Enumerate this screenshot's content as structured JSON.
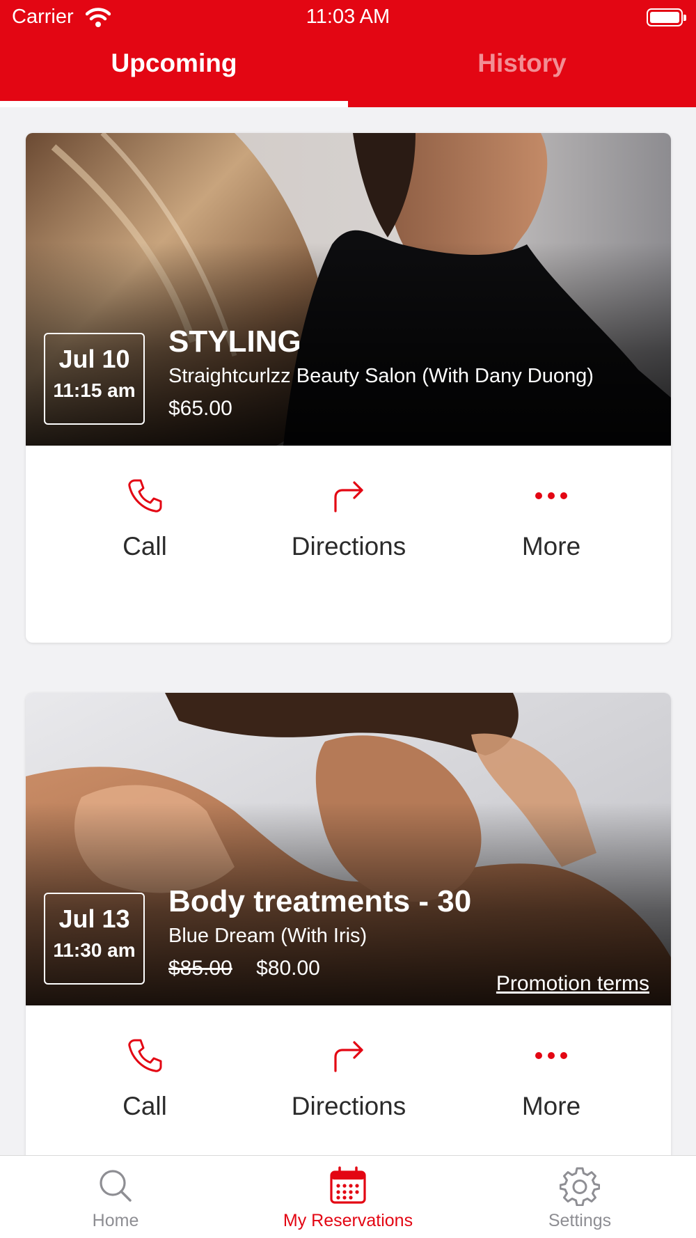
{
  "status_bar": {
    "carrier": "Carrier",
    "time": "11:03 AM"
  },
  "tabs": [
    {
      "label": "Upcoming",
      "active": true
    },
    {
      "label": "History",
      "active": false
    }
  ],
  "reservations": [
    {
      "date": "Jul 10",
      "time": "11:15 am",
      "title": "STYLING",
      "venue": "Straightcurlzz Beauty Salon (With Dany Duong)",
      "price": "$65.00",
      "image": "woman-ponytail-photo"
    },
    {
      "date": "Jul 13",
      "time": "11:30 am",
      "title": "Body treatments - 30",
      "venue": "Blue Dream (With Iris)",
      "original_price": "$85.00",
      "price": "$80.00",
      "promotion_link": "Promotion terms",
      "image": "massage-photo"
    }
  ],
  "actions": {
    "call": "Call",
    "directions": "Directions",
    "more": "More"
  },
  "bottom_nav": [
    {
      "label": "Home",
      "icon": "search-icon",
      "active": false
    },
    {
      "label": "My Reservations",
      "icon": "calendar-icon",
      "active": true
    },
    {
      "label": "Settings",
      "icon": "gear-icon",
      "active": false
    }
  ],
  "colors": {
    "accent": "#e30613",
    "background": "#f2f2f4",
    "inactive": "#8e8e93"
  }
}
